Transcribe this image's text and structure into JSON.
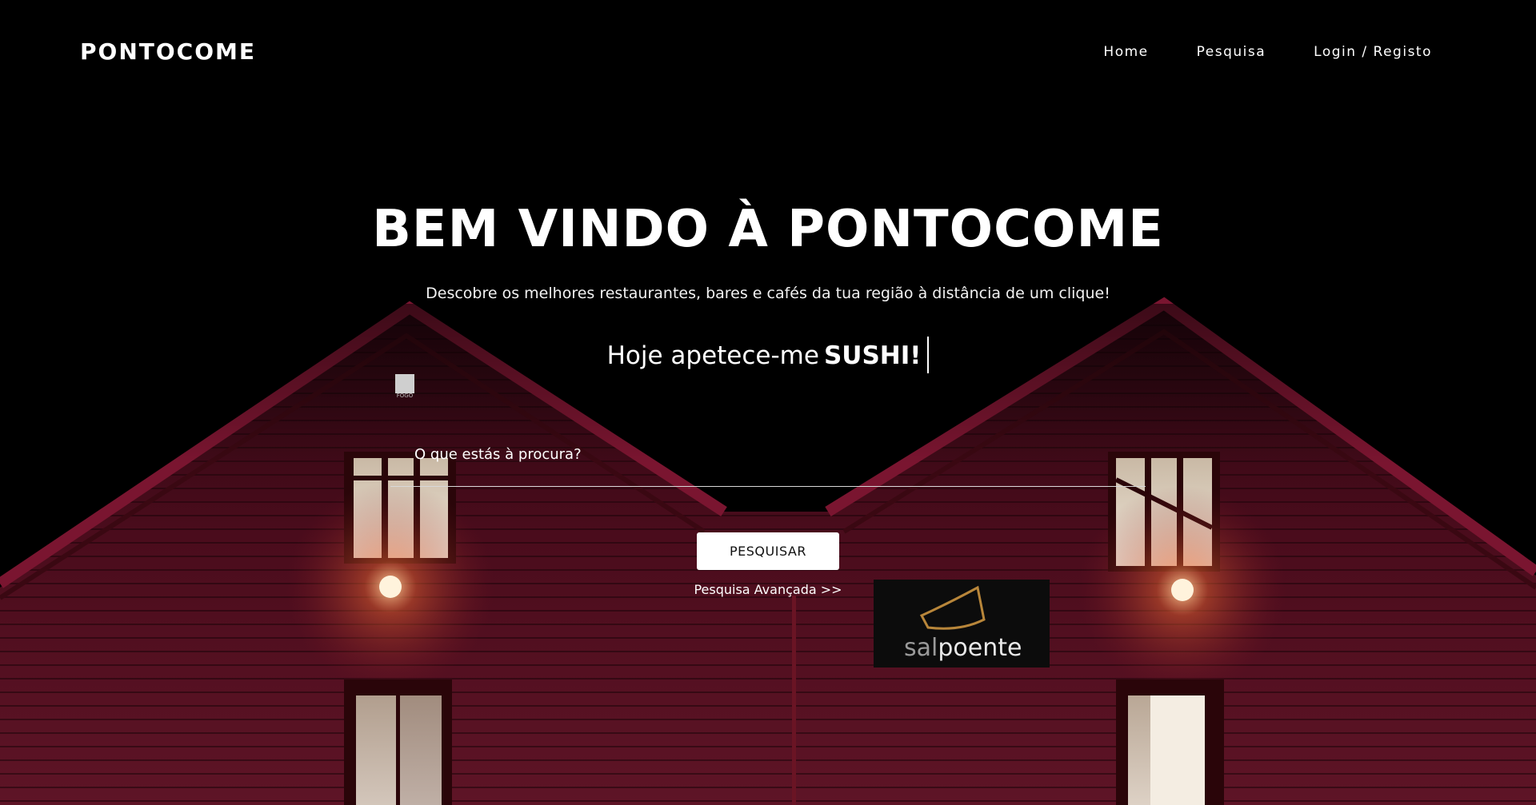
{
  "nav": {
    "brand": "PONTOCOME",
    "links": [
      "Home",
      "Pesquisa",
      "Login / Registo"
    ]
  },
  "hero": {
    "title": "BEM VINDO À PONTOCOME",
    "subtitle": "Descobre os melhores restaurantes, bares e cafés da tua região à distância de um clique!",
    "typer_prefix": "Hoje apetece-me",
    "typer_word": "SUSHI!"
  },
  "search": {
    "label": "O que estás à procura?",
    "value": "",
    "button_label": "PESQUISAR",
    "advanced_link": "Pesquisa Avançada >>"
  },
  "background": {
    "sign_text_light": "sal",
    "sign_text_bold": "poente",
    "door_placard": "FOGO",
    "wall_color": "#5a1020"
  }
}
